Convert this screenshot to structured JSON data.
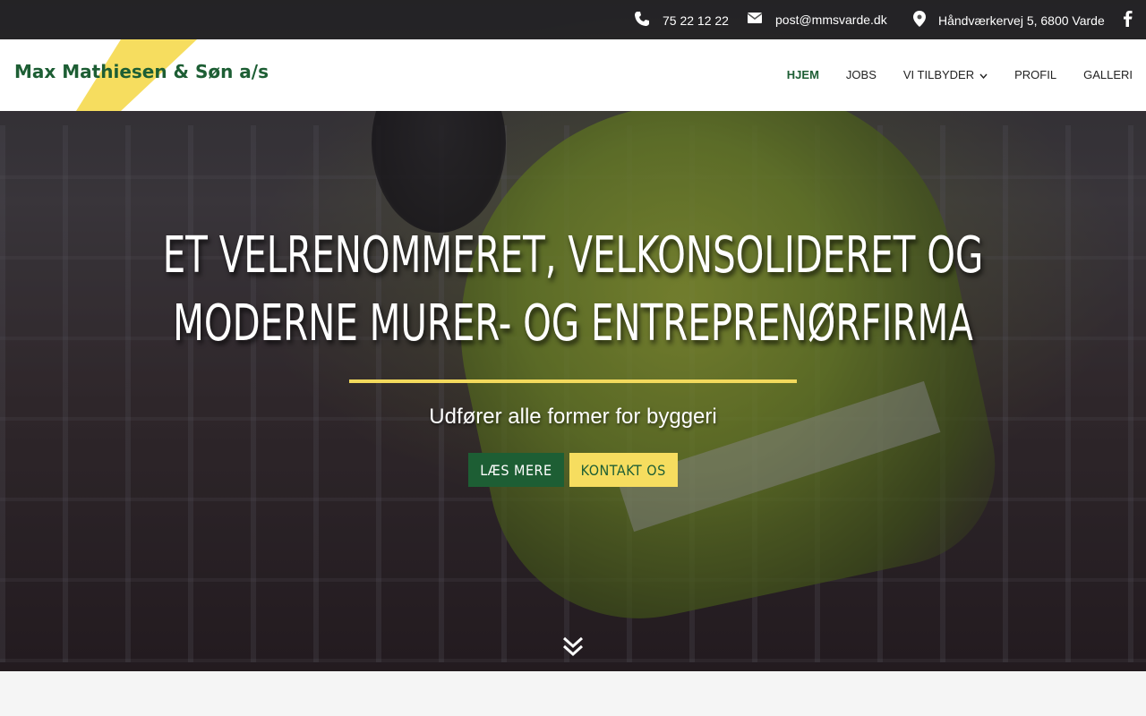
{
  "topbar": {
    "phone": "75 22 12 22",
    "email": "post@mmsvarde.dk",
    "address": "Håndværkervej 5, 6800 Varde",
    "icons": [
      "phone-icon",
      "envelope-icon",
      "map-marker-icon",
      "facebook-icon"
    ]
  },
  "header": {
    "logo_text": "Max Mathiesen & Søn a/s",
    "nav": [
      {
        "label": "HJEM",
        "active": true
      },
      {
        "label": "JOBS"
      },
      {
        "label": "VI TILBYDER",
        "dropdown": true
      },
      {
        "label": "PROFIL"
      },
      {
        "label": "GALLERI"
      }
    ]
  },
  "hero": {
    "title_line1": "ET VELRENOMMERET, VELKONSOLIDERET OG",
    "title_line2": "MODERNE MURER- OG ENTREPRENØRFIRMA",
    "subtitle": "Udfører alle former for byggeri",
    "buttons": {
      "read_more": "LÆS MERE",
      "contact": "KONTAKT OS"
    },
    "scroll_icon": "double-chevron-down-icon"
  },
  "colors": {
    "brand_green": "#1d5e34",
    "accent_yellow": "#f6dd5f"
  }
}
